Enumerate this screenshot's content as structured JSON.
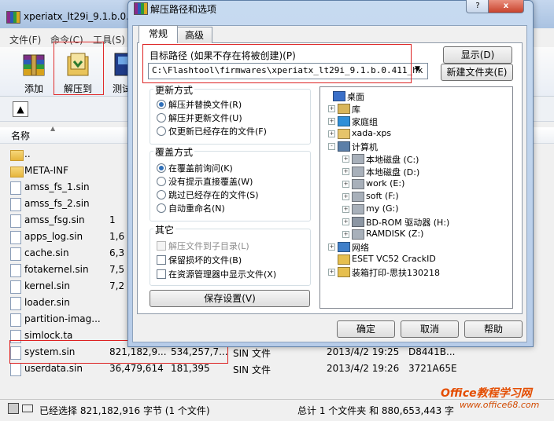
{
  "main": {
    "title": "xperiatx_lt29i_9.1.b.0.41",
    "menu": [
      "文件(F)",
      "命令(C)",
      "工具(S)"
    ],
    "toolbar": {
      "add": "添加",
      "extract_to": "解压到",
      "test": "测试"
    },
    "column_name": "名称",
    "files": [
      {
        "name": "..",
        "type": "folder",
        "size": "",
        "packed": "",
        "kind": "",
        "modified": "",
        "crc": ""
      },
      {
        "name": "META-INF",
        "type": "folder",
        "size": "",
        "packed": "",
        "kind": "",
        "modified": "",
        "crc": ""
      },
      {
        "name": "amss_fs_1.sin",
        "type": "file",
        "size": "",
        "packed": "",
        "kind": "",
        "modified": "",
        "crc": ""
      },
      {
        "name": "amss_fs_2.sin",
        "type": "file",
        "size": "",
        "packed": "",
        "kind": "",
        "modified": "",
        "crc": ""
      },
      {
        "name": "amss_fsg.sin",
        "type": "file",
        "size": "1",
        "packed": "",
        "kind": "",
        "modified": "",
        "crc": ""
      },
      {
        "name": "apps_log.sin",
        "type": "file",
        "size": "1,6",
        "packed": "",
        "kind": "",
        "modified": "",
        "crc": ""
      },
      {
        "name": "cache.sin",
        "type": "file",
        "size": "6,3",
        "packed": "",
        "kind": "",
        "modified": "",
        "crc": ""
      },
      {
        "name": "fotakernel.sin",
        "type": "file",
        "size": "7,5",
        "packed": "",
        "kind": "",
        "modified": "",
        "crc": ""
      },
      {
        "name": "kernel.sin",
        "type": "file",
        "size": "7,2",
        "packed": "",
        "kind": "",
        "modified": "",
        "crc": ""
      },
      {
        "name": "loader.sin",
        "type": "file",
        "size": "",
        "packed": "",
        "kind": "",
        "modified": "",
        "crc": ""
      },
      {
        "name": "partition-imag...",
        "type": "file",
        "size": "",
        "packed": "",
        "kind": "",
        "modified": "",
        "crc": ""
      },
      {
        "name": "simlock.ta",
        "type": "file",
        "size": "",
        "packed": "",
        "kind": "",
        "modified": "",
        "crc": ""
      },
      {
        "name": "system.sin",
        "type": "file",
        "size": "821,182,9...",
        "packed": "534,257,7...",
        "kind": "SIN 文件",
        "modified": "2013/4/2 19:25",
        "crc": "D8441B..."
      },
      {
        "name": "userdata.sin",
        "type": "file",
        "size": "36,479,614",
        "packed": "181,395",
        "kind": "SIN 文件",
        "modified": "2013/4/2 19:26",
        "crc": "3721A65E"
      }
    ],
    "status_left": "已经选择 821,182,916 字节 (1 个文件)",
    "status_right": "总计 1 个文件夹 和 880,653,443 字",
    "watermark_main": "Office教程学习网",
    "watermark_sub": "www.office68.com"
  },
  "dialog": {
    "title": "解压路径和选项",
    "help_glyph": "?",
    "close_glyph": "x",
    "tabs": [
      "常规",
      "高级"
    ],
    "target_label": "目标路径 (如果不存在将被创建)(P)",
    "path_value": "C:\\Flashtool\\firmwares\\xperiatx_lt29i_9.1.b.0.411_hk",
    "show_button": "显示(D)",
    "new_folder_button": "新建文件夹(E)",
    "update_group": {
      "title": "更新方式",
      "options": [
        {
          "label": "解压并替换文件(R)",
          "selected": true
        },
        {
          "label": "解压并更新文件(U)",
          "selected": false
        },
        {
          "label": "仅更新已经存在的文件(F)",
          "selected": false
        }
      ]
    },
    "overwrite_group": {
      "title": "覆盖方式",
      "options": [
        {
          "label": "在覆盖前询问(K)",
          "selected": true
        },
        {
          "label": "没有提示直接覆盖(W)",
          "selected": false
        },
        {
          "label": "跳过已经存在的文件(S)",
          "selected": false
        },
        {
          "label": "自动重命名(N)",
          "selected": false
        }
      ]
    },
    "misc_group": {
      "title": "其它",
      "options": [
        {
          "label": "解压文件到子目录(L)",
          "checked": false,
          "disabled": true
        },
        {
          "label": "保留损坏的文件(B)",
          "checked": false,
          "disabled": false
        },
        {
          "label": "在资源管理器中显示文件(X)",
          "checked": false,
          "disabled": false
        }
      ]
    },
    "save_button": "保存设置(V)",
    "tree": [
      {
        "label": "桌面",
        "icon": "desktop-icon",
        "level": 0,
        "expander": ""
      },
      {
        "label": "库",
        "icon": "library-icon",
        "level": 1,
        "expander": "+"
      },
      {
        "label": "家庭组",
        "icon": "homegroup-icon",
        "level": 1,
        "expander": "+"
      },
      {
        "label": "xada-xps",
        "icon": "user-folder-icon",
        "level": 1,
        "expander": "+"
      },
      {
        "label": "计算机",
        "icon": "computer-icon",
        "level": 1,
        "expander": "-"
      },
      {
        "label": "本地磁盘 (C:)",
        "icon": "drive-icon",
        "level": 2,
        "expander": "+"
      },
      {
        "label": "本地磁盘 (D:)",
        "icon": "drive-icon",
        "level": 2,
        "expander": "+"
      },
      {
        "label": "work (E:)",
        "icon": "drive-icon",
        "level": 2,
        "expander": "+"
      },
      {
        "label": "soft (F:)",
        "icon": "drive-icon",
        "level": 2,
        "expander": "+"
      },
      {
        "label": "my (G:)",
        "icon": "drive-icon",
        "level": 2,
        "expander": "+"
      },
      {
        "label": "BD-ROM 驱动器 (H:)",
        "icon": "optical-drive-icon",
        "level": 2,
        "expander": "+"
      },
      {
        "label": "RAMDISK (Z:)",
        "icon": "drive-icon",
        "level": 2,
        "expander": "+"
      },
      {
        "label": "网络",
        "icon": "network-icon",
        "level": 1,
        "expander": "+"
      },
      {
        "label": "ESET VC52 CrackID",
        "icon": "folder-icon",
        "level": 1,
        "expander": ""
      },
      {
        "label": "装箱打印-思扶130218",
        "icon": "folder-icon",
        "level": 1,
        "expander": "+"
      }
    ],
    "ok_button": "确定",
    "cancel_button": "取消",
    "help_button": "帮助"
  }
}
